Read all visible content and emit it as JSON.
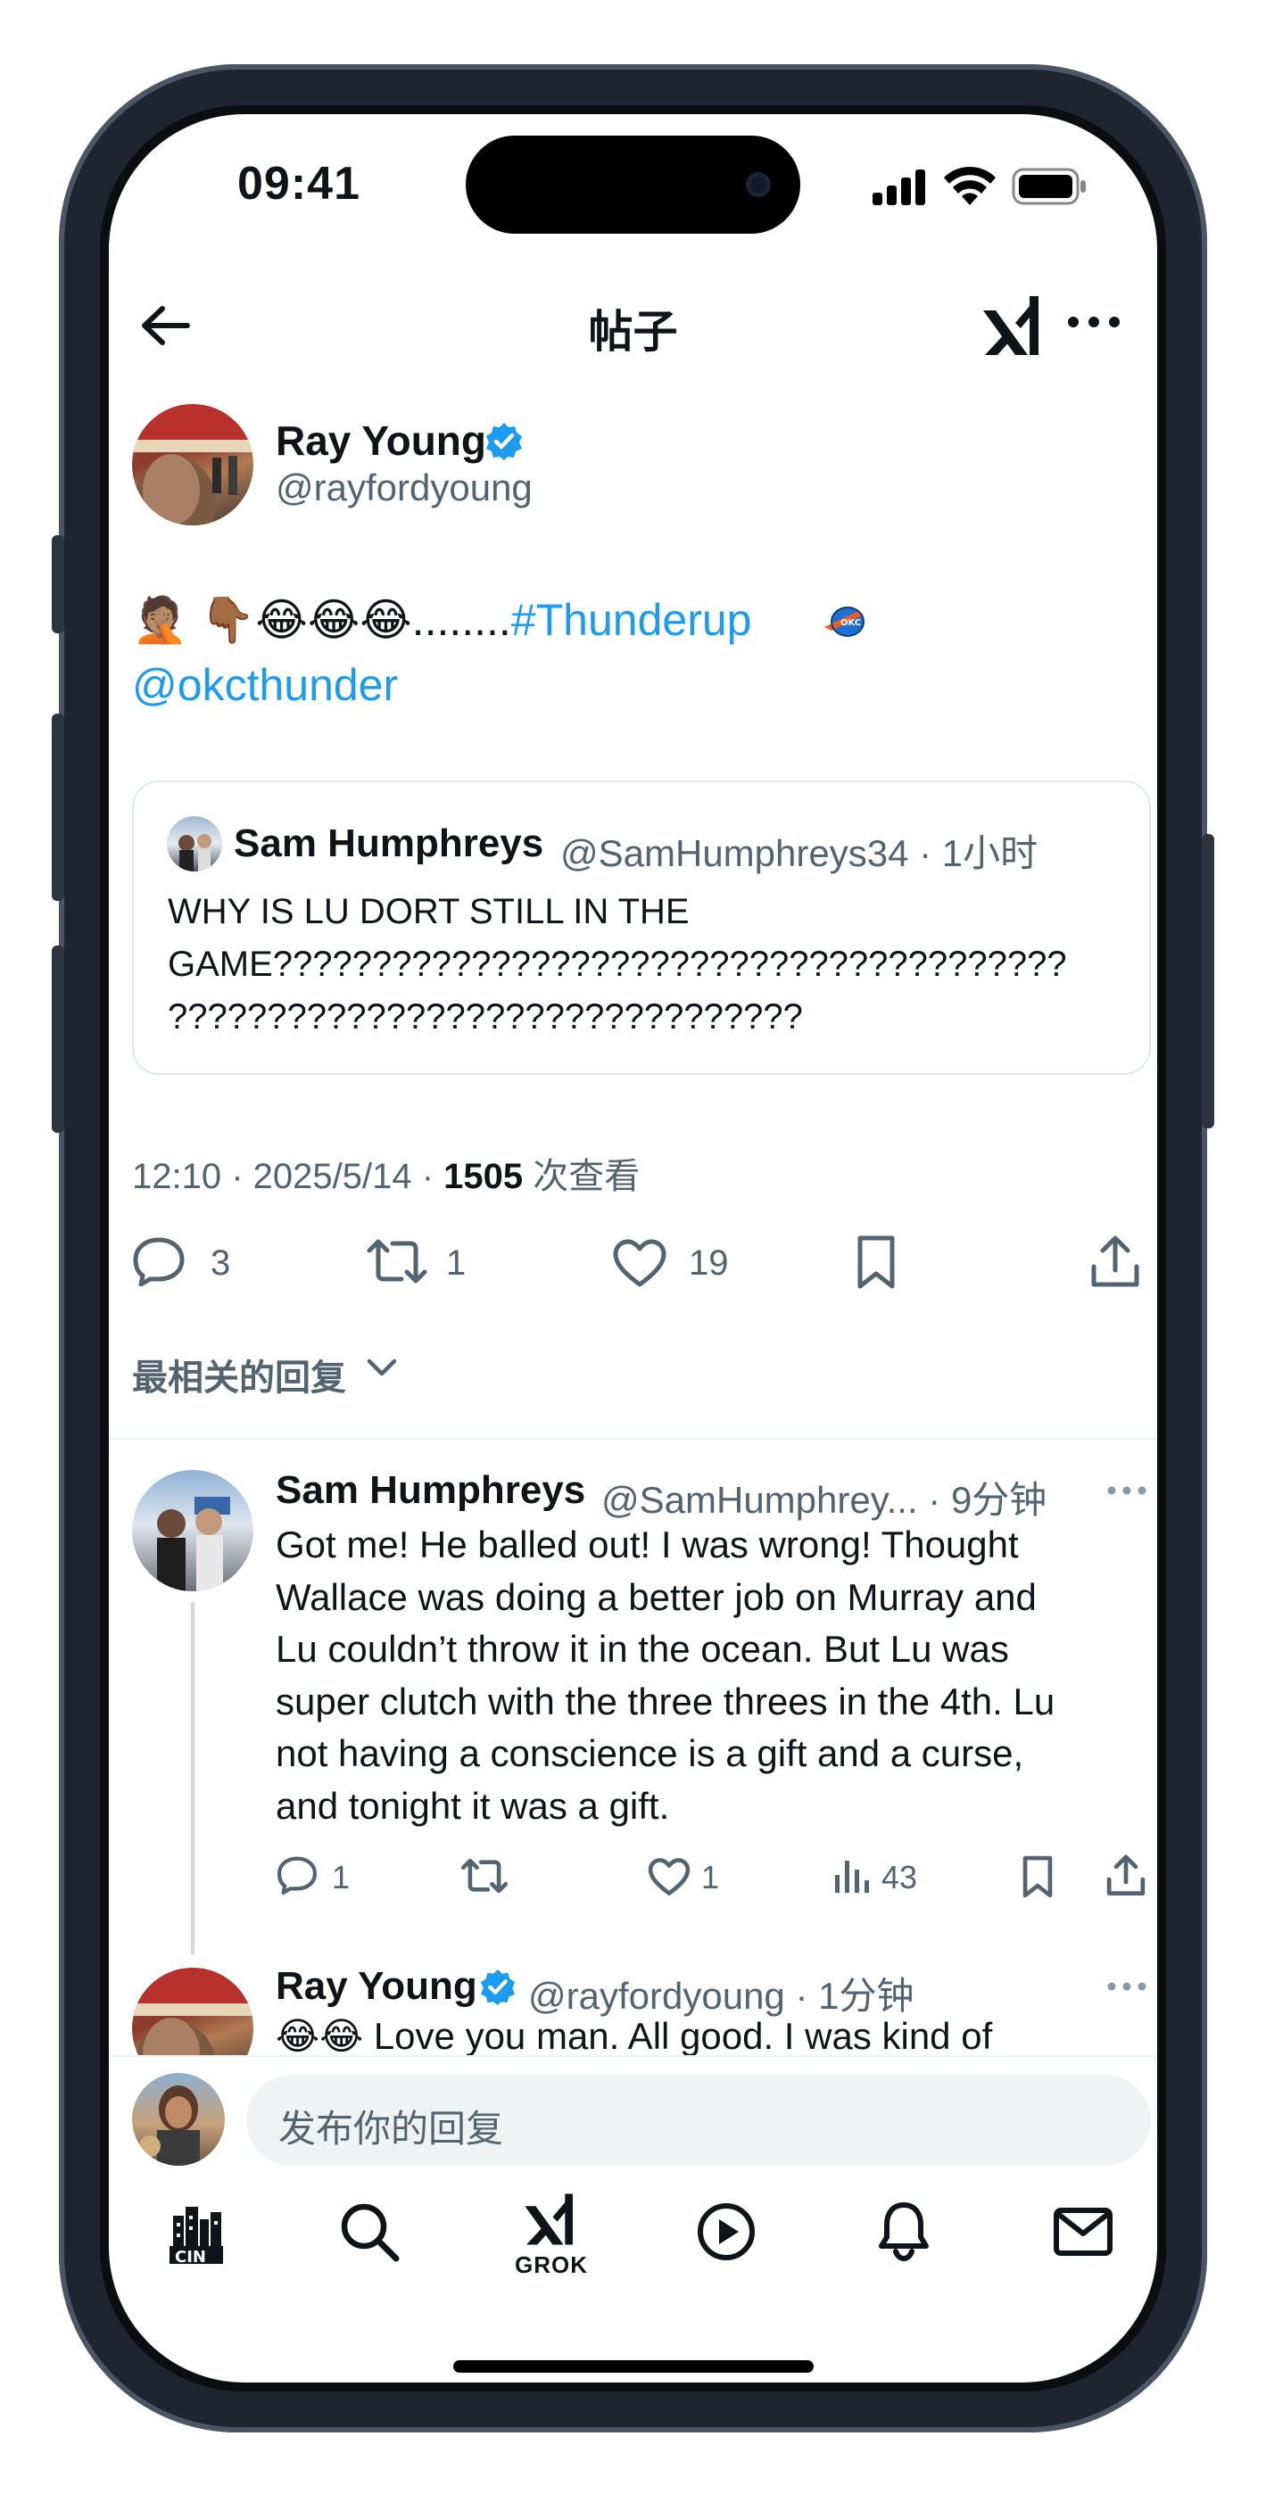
{
  "status_bar": {
    "time": "09:41"
  },
  "header": {
    "title": "帖子"
  },
  "main_post": {
    "author_name": "Ray Young",
    "author_handle": "@rayfordyoung",
    "body_emoji": "🤦🏽 👇🏾😂😂😂",
    "body_dots": "........",
    "hashtag": "#Thunderup",
    "mention": "@okcthunder",
    "quoted": {
      "author_name": "Sam Humphreys",
      "meta": "@SamHumphreys34 · 1小时",
      "lines": [
        "WHY IS LU DORT STILL IN THE",
        "GAME????????????????????????????????????????",
        "????????????????????????????????"
      ]
    },
    "timestamp": "12:10 · 2025/5/14 · ",
    "views_count": "1505",
    "views_label": " 次查看",
    "stats": {
      "replies": "3",
      "reposts": "1",
      "likes": "19"
    }
  },
  "replies_filter": {
    "label": "最相关的回复"
  },
  "replies": [
    {
      "author_name": "Sam Humphreys",
      "meta": "@SamHumphrey... · 9分钟",
      "lines": [
        "Got me! He balled out! I was wrong! Thought",
        "Wallace was doing a better job on Murray and",
        "Lu couldn’t throw it in the ocean. But Lu was",
        "super clutch with the three threes in the 4th. Lu",
        "not having a conscience is a gift and a curse,",
        "and tonight it was a gift."
      ],
      "stats": {
        "replies": "1",
        "likes": "1",
        "views": "43"
      }
    },
    {
      "author_name": "Ray Young",
      "meta": "@rayfordyoung · 1分钟",
      "line_emoji": "😂😂",
      "line_text": " Love you man. All good. I was kind of"
    }
  ],
  "reply_composer": {
    "placeholder": "发布你的回复"
  },
  "tab_bar": {
    "grok_label": "GROK"
  },
  "colors": {
    "accent": "#1d9bf0",
    "text": "#0f1419",
    "secondary": "#536471"
  }
}
